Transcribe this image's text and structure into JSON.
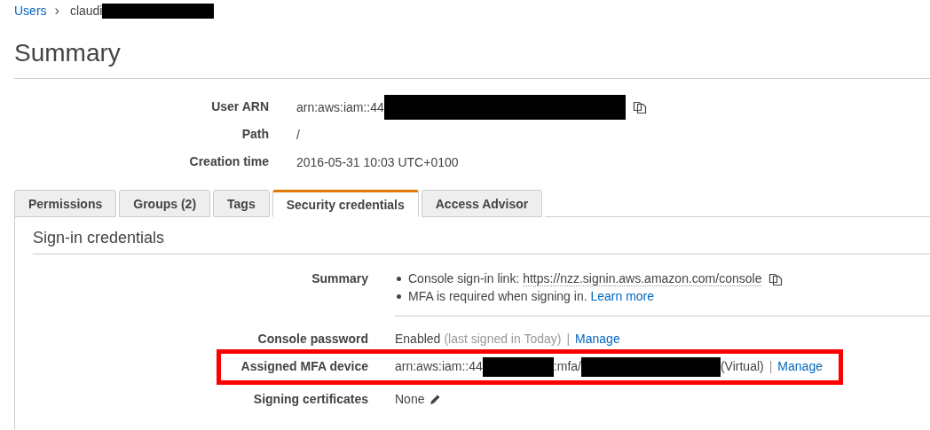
{
  "breadcrumb": [
    {
      "kind": "link",
      "text": "Users"
    },
    {
      "kind": "separator",
      "text": "›"
    },
    {
      "kind": "text",
      "text": "claudi"
    },
    {
      "kind": "redaction"
    }
  ],
  "title": "Summary",
  "summary_fields": [
    {
      "label": "User ARN",
      "segments": [
        {
          "kind": "text",
          "text": "arn:aws:iam::44"
        },
        {
          "kind": "redaction"
        },
        {
          "kind": "copy"
        }
      ]
    },
    {
      "label": "Path",
      "segments": [
        {
          "kind": "text",
          "text": "/"
        }
      ]
    },
    {
      "label": "Creation time",
      "segments": [
        {
          "kind": "text",
          "text": "2016-05-31 10:03 UTC+0100"
        }
      ]
    }
  ],
  "tabs": [
    {
      "label": "Permissions",
      "selected": false
    },
    {
      "label": "Groups (2)",
      "selected": false
    },
    {
      "label": "Tags",
      "selected": false
    },
    {
      "label": "Security credentials",
      "selected": true
    },
    {
      "label": "Access Advisor",
      "selected": false
    }
  ],
  "section_title": "Sign-in credentials",
  "summary_row": {
    "label": "Summary",
    "bullets": [
      {
        "segments": [
          {
            "kind": "text",
            "text": "Console sign-in link: "
          },
          {
            "kind": "url",
            "text": "https://nzz.signin.aws.amazon.com/console"
          },
          {
            "kind": "copy"
          }
        ]
      },
      {
        "segments": [
          {
            "kind": "text",
            "text": "MFA is required when signing in. "
          },
          {
            "kind": "link",
            "text": "Learn more"
          }
        ]
      }
    ]
  },
  "credential_rows": [
    {
      "label": "Console password",
      "highlighted": false,
      "segments": [
        {
          "kind": "text",
          "text": "Enabled"
        },
        {
          "kind": "muted",
          "text": "(last signed in Today)"
        },
        {
          "kind": "pipe",
          "text": "|"
        },
        {
          "kind": "link",
          "text": "Manage"
        }
      ]
    },
    {
      "label": "Assigned MFA device",
      "highlighted": true,
      "segments": [
        {
          "kind": "text",
          "text": "arn:aws:iam::44"
        },
        {
          "kind": "redaction"
        },
        {
          "kind": "text",
          "text": ":mfa/"
        },
        {
          "kind": "redaction"
        },
        {
          "kind": "text",
          "text": "(Virtual)"
        },
        {
          "kind": "pipe",
          "text": "|"
        },
        {
          "kind": "link",
          "text": "Manage"
        }
      ]
    },
    {
      "label": "Signing certificates",
      "highlighted": false,
      "segments": [
        {
          "kind": "text",
          "text": "None"
        },
        {
          "kind": "edit"
        }
      ]
    }
  ]
}
